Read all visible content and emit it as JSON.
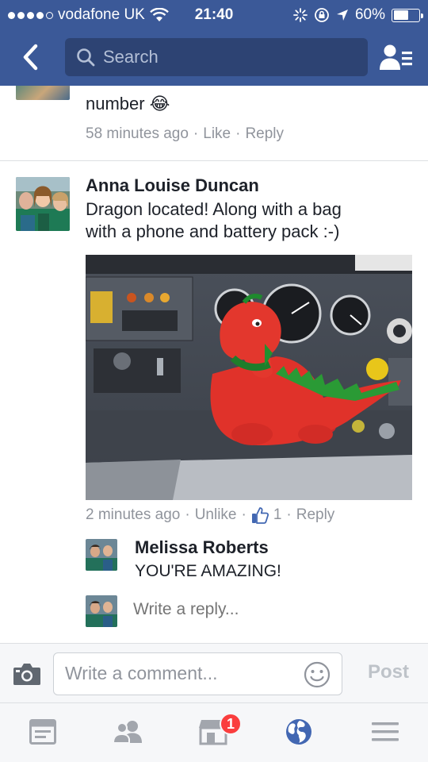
{
  "status_bar": {
    "carrier": "vodafone UK",
    "time": "21:40",
    "battery": "60%",
    "signal_bars": 4
  },
  "nav": {
    "search_placeholder": "Search"
  },
  "previous_comment": {
    "text": "number 😂",
    "time": "58 minutes ago",
    "like": "Like",
    "reply": "Reply",
    "sep": "·"
  },
  "comment": {
    "author": "Anna Louise Duncan",
    "text_line1": "Dragon located! Along with a bag",
    "text_line2": "with a phone and battery pack :-)",
    "time": "2 minutes ago",
    "unlike": "Unlike",
    "like_count": "1",
    "reply": "Reply",
    "sep": "·"
  },
  "reply": {
    "author": "Melissa Roberts",
    "text": "YOU'RE AMAZING!"
  },
  "reply_input": {
    "placeholder": "Write a reply..."
  },
  "composer": {
    "placeholder": "Write a comment...",
    "post_label": "Post"
  },
  "tabbar": {
    "marketplace_badge": "1"
  },
  "colors": {
    "brand": "#3b5998",
    "search_bg": "#2d4373",
    "meta": "#90949c",
    "link_blue": "#4267b2",
    "badge": "#fa3e3e"
  }
}
